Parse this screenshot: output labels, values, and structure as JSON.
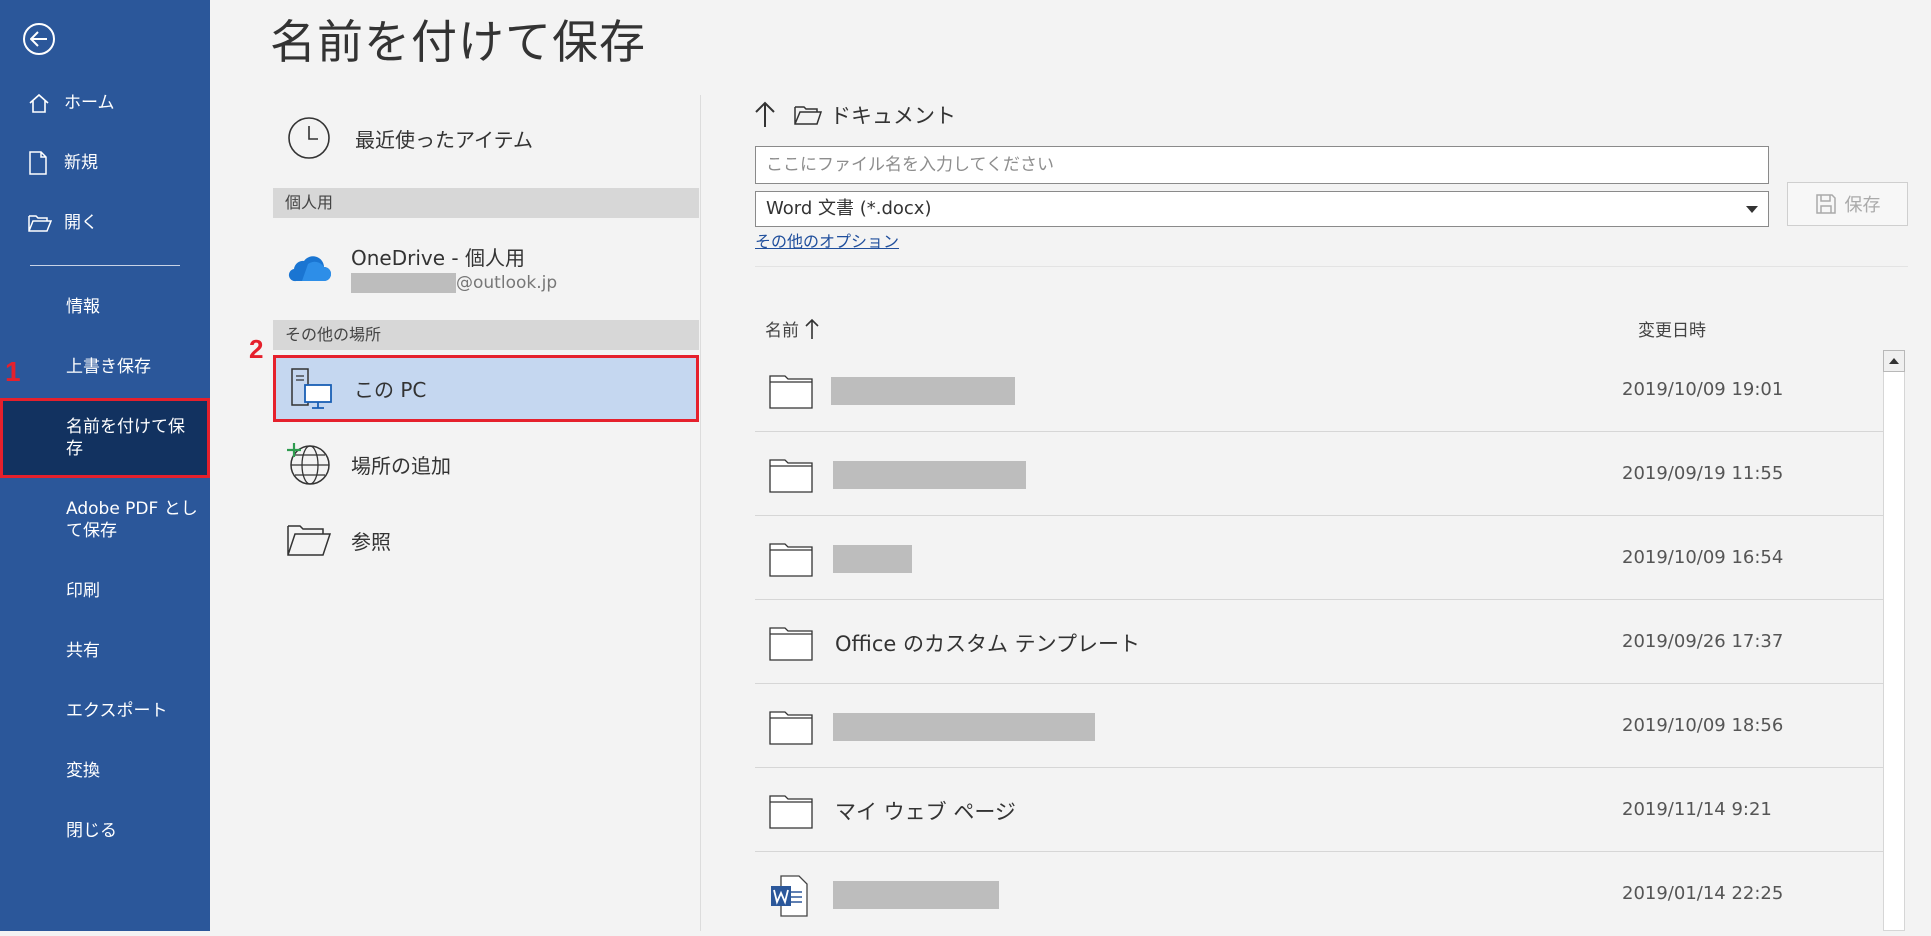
{
  "nav": {
    "items": [
      {
        "label": "ホーム",
        "icon": "home-icon"
      },
      {
        "label": "新規",
        "icon": "new-document-icon"
      },
      {
        "label": "開く",
        "icon": "open-folder-icon"
      },
      {
        "label": "情報"
      },
      {
        "label": "上書き保存"
      },
      {
        "label": "名前を付けて保\n存",
        "active": true
      },
      {
        "label": "Adobe PDF とし\nて保存"
      },
      {
        "label": "印刷"
      },
      {
        "label": "共有"
      },
      {
        "label": "エクスポート"
      },
      {
        "label": "変換"
      },
      {
        "label": "閉じる"
      }
    ]
  },
  "annotations": {
    "step1": "1",
    "step2": "2"
  },
  "title": "名前を付けて保存",
  "places": {
    "recent": "最近使ったアイテム",
    "personal_header": "個人用",
    "onedrive_name": "OneDrive - 個人用",
    "onedrive_account": "@outlook.jp",
    "other_header": "その他の場所",
    "this_pc": "この PC",
    "add_place": "場所の追加",
    "browse": "参照"
  },
  "location": {
    "path": "ドキュメント"
  },
  "filename": {
    "value": "",
    "placeholder": "ここにファイル名を入力してください"
  },
  "filetype": {
    "selected": "Word 文書 (*.docx)"
  },
  "save_button": "保存",
  "more_options": "その他のオプション",
  "columns": {
    "name": "名前",
    "modified": "変更日時"
  },
  "files": [
    {
      "name": "",
      "date": "2019/10/09 19:01",
      "type": "folder"
    },
    {
      "name": "",
      "date": "2019/09/19 11:55",
      "type": "folder"
    },
    {
      "name": "",
      "date": "2019/10/09 16:54",
      "type": "folder"
    },
    {
      "name": "Office のカスタム テンプレート",
      "date": "2019/09/26 17:37",
      "type": "folder"
    },
    {
      "name": "",
      "date": "2019/10/09 18:56",
      "type": "folder"
    },
    {
      "name": "マイ ウェブ ページ",
      "date": "2019/11/14 9:21",
      "type": "folder"
    },
    {
      "name": "",
      "date": "2019/01/14 22:25",
      "type": "word-document"
    }
  ],
  "colors": {
    "nav_bg": "#2b579a",
    "nav_active": "#123260",
    "highlight": "#e5202c",
    "selected_bg": "#c5d7f0"
  }
}
